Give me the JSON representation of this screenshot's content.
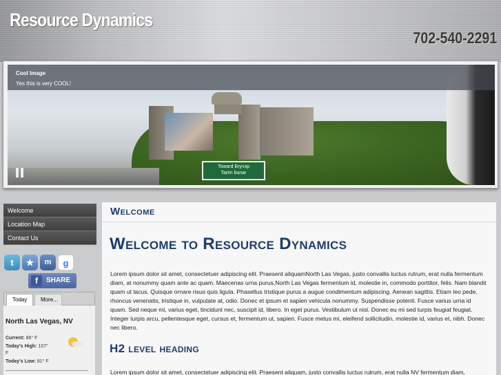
{
  "header": {
    "site_title": "Resource Dynamics",
    "phone": "702-540-2291"
  },
  "slideshow": {
    "caption_title": "Cool Image",
    "caption_text": "Yes this is very COOL!",
    "sign_line1": "Toward Бrучэp",
    "sign_line2": "Tarim bunar"
  },
  "sidebar": {
    "nav": [
      {
        "label": "Welcome"
      },
      {
        "label": "Location Map"
      },
      {
        "label": "Contact Us"
      }
    ],
    "social": {
      "icons": [
        "twitter-icon",
        "favorites-star-icon",
        "myspace-icon",
        "google-icon"
      ],
      "share_label": "SHARE"
    },
    "weather": {
      "tabs": [
        "Today",
        "More..."
      ],
      "city": "North Las Vegas, NV",
      "current_label": "Current:",
      "current_value": "86° F",
      "high_label": "Today's High:",
      "high_value": "107°",
      "high_unit": "F",
      "low_label": "Today's Low:",
      "low_value": "81° F",
      "icon": "sunny-icon"
    }
  },
  "main": {
    "section_title": "Welcome",
    "heading": "Welcome to Resource Dynamics",
    "paragraph1": "Lorem ipsum dolor sit amet, consectetuer adipiscing elit. Praesent aliquamNorth Las Vegas, justo convallis luctus rutrum, erat nulla fermentum diam, at nonummy quam ante ac quam. Maecenas urna purus,North Las Vegas fermentum id, molestie in, commodo porttitor, felis. Nam blandit quam ut lacus. Quisque ornare risus quis ligula. Phasellus tristique purus a augue condimentum adipiscing. Aenean sagittis. Etiam leo pede, rhoncus venenatis, tristique in, vulputate at, odio. Donec et ipsum et sapien vehicula nonummy. Suspendisse potenti. Fusce varius urna id quam. Sed neque mi, varius eget, tincidunt nec, suscipit id, libero. In eget purus. Vestibulum ut nisl. Donec eu mi sed turpis feugiat feugiat. Integer turpis arcu, pellentesque eget, cursus et, fermentum ut, sapien. Fusce metus mi, eleifend sollicitudin, molestie id, varius et, nibh. Donec nec libero.",
    "heading2": "H2 level heading",
    "paragraph2": "Lorem ipsum dolor sit amet, consectetuer adipiscing elit. Praesent aliquam, justo convallis luctus rutrum, erat nulla NV fermentum diam,"
  },
  "colors": {
    "heading_blue": "#1d3d6b",
    "nav_bg": "#4a4a4a"
  }
}
